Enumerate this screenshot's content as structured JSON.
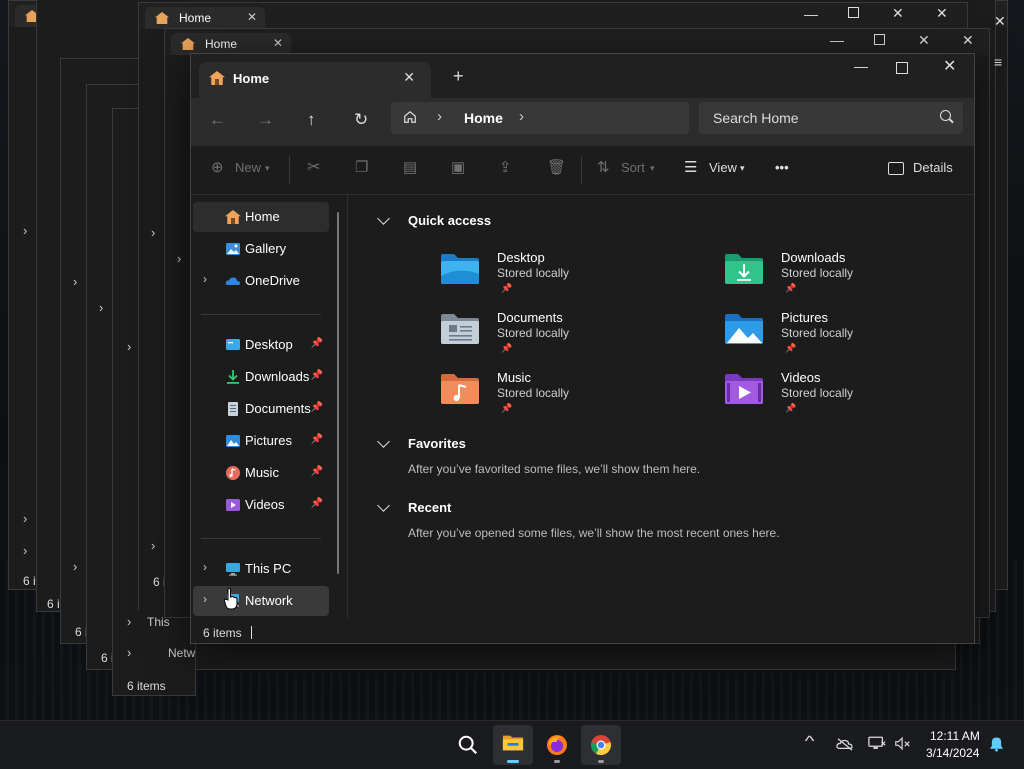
{
  "window": {
    "tab_title": "Home",
    "tab_close": "✕",
    "new_tab": "+",
    "min": "—",
    "close": "✕"
  },
  "bg_windows": {
    "tab_title": "Home",
    "status": "6 items",
    "status_short": "6 i",
    "this_pc_partial": "This",
    "network_label": "Network"
  },
  "nav": {
    "back": "←",
    "forward": "→",
    "up": "↑",
    "refresh": "↻",
    "chevron": "›",
    "address_current": "Home"
  },
  "search": {
    "placeholder": "Search Home"
  },
  "cmdbar": {
    "new": "New",
    "sort": "Sort",
    "view": "View",
    "more": "•••",
    "details": "Details"
  },
  "sidebar": {
    "home": "Home",
    "gallery": "Gallery",
    "onedrive": "OneDrive",
    "pinned": [
      {
        "label": "Desktop"
      },
      {
        "label": "Downloads"
      },
      {
        "label": "Documents"
      },
      {
        "label": "Pictures"
      },
      {
        "label": "Music"
      },
      {
        "label": "Videos"
      }
    ],
    "this_pc": "This PC",
    "network": "Network",
    "expand": "›"
  },
  "content": {
    "quick_access": "Quick access",
    "items": [
      {
        "name": "Desktop",
        "sub": "Stored locally"
      },
      {
        "name": "Downloads",
        "sub": "Stored locally"
      },
      {
        "name": "Documents",
        "sub": "Stored locally"
      },
      {
        "name": "Pictures",
        "sub": "Stored locally"
      },
      {
        "name": "Music",
        "sub": "Stored locally"
      },
      {
        "name": "Videos",
        "sub": "Stored locally"
      }
    ],
    "favorites": "Favorites",
    "favorites_note": "After you’ve favorited some files, we’ll show them here.",
    "recent": "Recent",
    "recent_note": "After you’ve opened some files, we’ll show the most recent ones here."
  },
  "status": {
    "items": "6 items"
  },
  "taskbar": {
    "time": "12:11 AM",
    "date": "3/14/2024",
    "tray_expand": "^"
  },
  "colors": {
    "accent": "#60cdff",
    "window_bg": "#1c1c1c",
    "folder_home": "#f0a35a"
  }
}
